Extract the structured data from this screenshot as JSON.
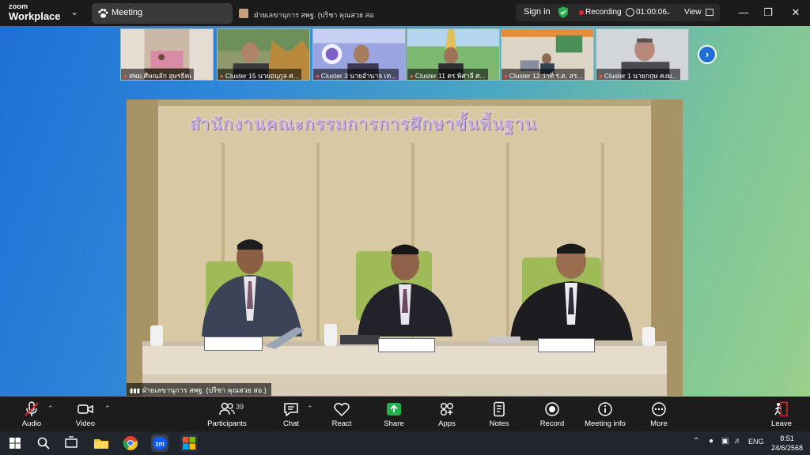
{
  "app": {
    "logo_line1": "zoom",
    "logo_line2": "Workplace",
    "meeting_tab": "Meeting",
    "share_tab": "ฝ่ายเลขานุการ สพฐ. (ปริชา คุณสวย สอ.)'s s",
    "sign_in": "Sign in",
    "recording_label": "Recording",
    "timer": "01:00:06",
    "view_label": "View"
  },
  "thumbnails": [
    {
      "name": "สพม.ศีษณลัก  อุษรธิคเ",
      "bg": "#b9a58f"
    },
    {
      "name": "Cluster 15 นายอนุกูล  ศ...",
      "bg": "#7a8a5c"
    },
    {
      "name": "Cluster 3 นายอำนาจ  เท...",
      "bg": "#7e77c8"
    },
    {
      "name": "Cluster 11 ดร.พิศาลี  ศ...",
      "bg": "#5fa86a"
    },
    {
      "name": "Cluster 12 ว่าที่ ร.ต. สร...",
      "bg": "#cfc9bb"
    },
    {
      "name": "Cluster 1 นายกฤษ  คงม...",
      "bg": "#cfd3d8"
    }
  ],
  "main_video": {
    "banner": "สำนักงานคณะกรรมการการศึกษาขั้นพื้นฐาน",
    "speaker": "ฝ่ายเลขานุการ สพฐ. (ปริชา  คุณสวย สอ.)"
  },
  "toolbar": {
    "audio": "Audio",
    "video": "Video",
    "participants": "Participants",
    "participants_count": "39",
    "chat": "Chat",
    "react": "React",
    "share": "Share",
    "apps": "Apps",
    "notes": "Notes",
    "record": "Record",
    "meeting_info": "Meeting info",
    "more": "More",
    "leave": "Leave"
  },
  "taskbar": {
    "language": "ENG",
    "time": "8:51",
    "date": "24/6/2568"
  },
  "colors": {
    "accent_green": "#22b14c",
    "recording_red": "#e0242d",
    "leave_red": "#e0242d",
    "zoom_blue": "#0b5cff"
  }
}
